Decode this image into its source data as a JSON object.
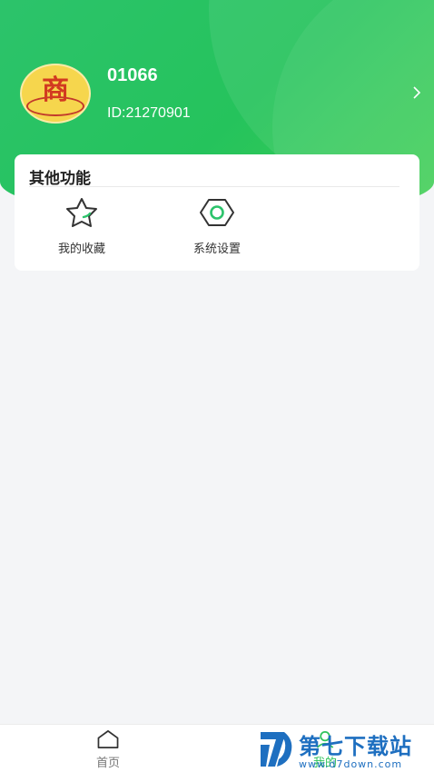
{
  "colors": {
    "accent": "#2cc36b",
    "card_bg": "#ffffff",
    "page_bg": "#f4f5f7",
    "watermark": "#1e6fc0"
  },
  "profile": {
    "avatar_icon": "shop-logo-icon",
    "avatar_glyph": "商",
    "username": "01066",
    "user_id": "ID:21270901",
    "chevron_icon": "chevron-right-icon"
  },
  "other_functions": {
    "title": "其他功能",
    "items": [
      {
        "label": "我的收藏",
        "icon": "star-icon"
      },
      {
        "label": "系统设置",
        "icon": "hexagon-settings-icon"
      }
    ]
  },
  "bottom_nav": {
    "items": [
      {
        "label": "首页",
        "icon": "home-icon",
        "active": false
      },
      {
        "label": "我的",
        "icon": "user-icon",
        "active": true
      }
    ]
  },
  "watermark": {
    "brand": "第七下载站",
    "url": "www.d7down.com"
  }
}
